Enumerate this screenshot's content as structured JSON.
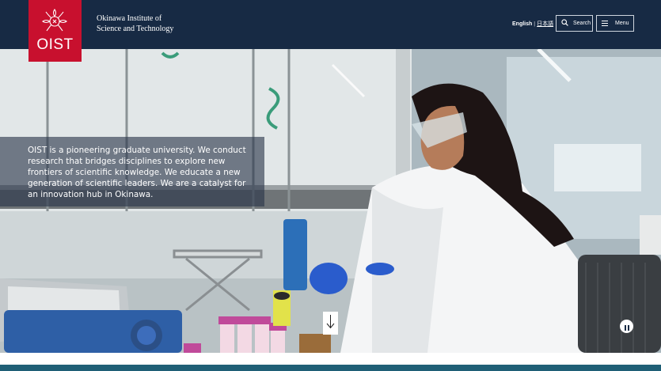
{
  "header": {
    "logo_text": "OIST",
    "institute_name_line1": "Okinawa Institute of",
    "institute_name_line2": "Science and Technology",
    "lang_english": "English",
    "lang_separator": "|",
    "lang_japanese": "日本語",
    "search_label": "Search",
    "menu_label": "Menu"
  },
  "hero": {
    "tagline": "OIST is a pioneering graduate university. We conduct research that bridges disciplines to explore new frontiers of scientific knowledge. We educate a new generation of scientific leaders. We are a catalyst for an innovation hub in Okinawa.",
    "scroll_icon": "arrow-down-icon",
    "pause_icon": "pause-icon"
  },
  "colors": {
    "header_bg": "#172a44",
    "logo_red": "#c8102e",
    "footer_teal": "#1f5f76"
  }
}
